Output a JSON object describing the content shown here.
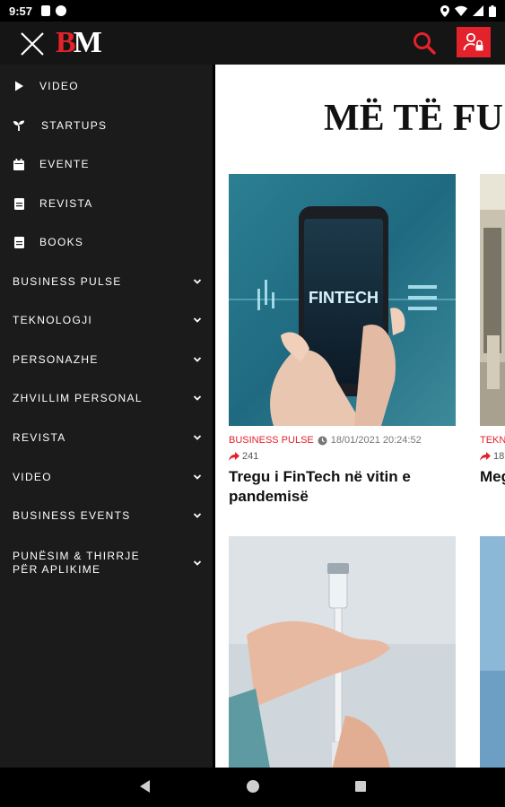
{
  "status_bar": {
    "time": "9:57"
  },
  "app": {
    "logo_b": "B",
    "logo_m": "M",
    "accent": "#e3222b"
  },
  "drawer": {
    "items": [
      {
        "label": "VIDEO",
        "icon": "play-icon"
      },
      {
        "label": "STARTUPS",
        "icon": "sprout-icon"
      },
      {
        "label": "EVENTE",
        "icon": "calendar-icon"
      },
      {
        "label": "REVISTA",
        "icon": "document-icon"
      },
      {
        "label": "BOOKS",
        "icon": "document-icon"
      }
    ],
    "sections": [
      {
        "label": "BUSINESS PULSE"
      },
      {
        "label": "TEKNOLOGJI"
      },
      {
        "label": "PERSONAZHE"
      },
      {
        "label": "ZHVILLIM PERSONAL"
      },
      {
        "label": "REVISTA"
      },
      {
        "label": "VIDEO"
      },
      {
        "label": "BUSINESS EVENTS"
      },
      {
        "label": "PUNËSIM & THIRRJE PËR APLIKIME"
      }
    ]
  },
  "main": {
    "section_title": "MË TË FU",
    "articles": [
      {
        "category": "BUSINESS PULSE",
        "date": "18/01/2021 20:24:52",
        "shares": "241",
        "title": "Tregu i FinTech në vitin e pandemisë",
        "image_text": "FINTECH"
      },
      {
        "category": "TEKN",
        "shares": "18",
        "title": "Meg për"
      }
    ]
  }
}
